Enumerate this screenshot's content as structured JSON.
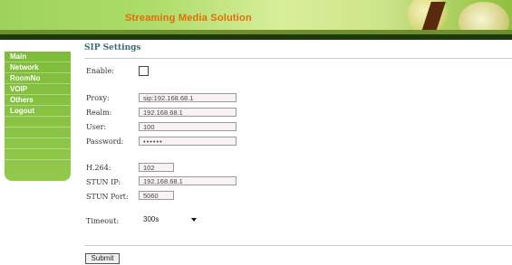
{
  "header": {
    "title": "Streaming Media Solution"
  },
  "sidebar": {
    "items": [
      "Main",
      "Network",
      "RoomNo",
      "VOIP",
      "Others",
      "Logout"
    ]
  },
  "page": {
    "title": "SIP Settings"
  },
  "form": {
    "enable": {
      "label": "Enable:",
      "checked": false
    },
    "proxy": {
      "label": "Proxy:",
      "value": "sip:192.168.68.1"
    },
    "realm": {
      "label": "Realm:",
      "value": "192.168.68.1"
    },
    "user": {
      "label": "User:",
      "value": "100"
    },
    "password": {
      "label": "Password:",
      "value": "••••••"
    },
    "h264": {
      "label": "H.264:",
      "value": "102"
    },
    "stun_ip": {
      "label": "STUN IP:",
      "value": "192.168.68.1"
    },
    "stun_port": {
      "label": "STUN Port:",
      "value": "5060"
    },
    "timeout": {
      "label": "Timeout:",
      "value": "300s"
    }
  },
  "actions": {
    "submit_label": "Submit"
  }
}
